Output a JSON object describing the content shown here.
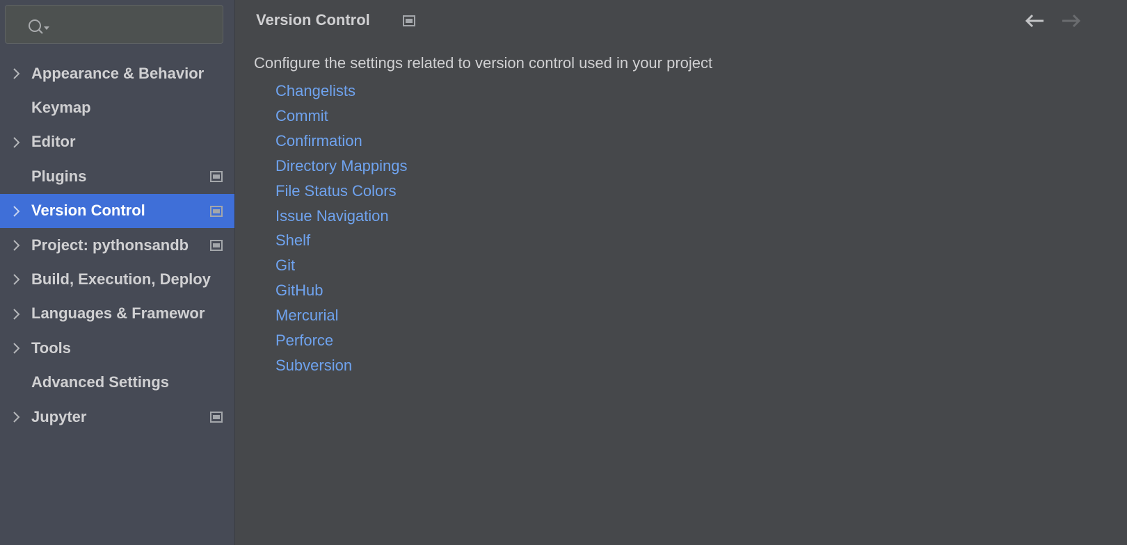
{
  "search": {
    "placeholder": "",
    "icon": "search-icon"
  },
  "sidebar": {
    "items": [
      {
        "label": "Appearance & Behavior",
        "expandable": true,
        "project_icon": false,
        "selected": false
      },
      {
        "label": "Keymap",
        "expandable": false,
        "project_icon": false,
        "selected": false
      },
      {
        "label": "Editor",
        "expandable": true,
        "project_icon": false,
        "selected": false
      },
      {
        "label": "Plugins",
        "expandable": false,
        "project_icon": true,
        "selected": false
      },
      {
        "label": "Version Control",
        "expandable": true,
        "project_icon": true,
        "selected": true
      },
      {
        "label": "Project: pythonsandb",
        "expandable": true,
        "project_icon": true,
        "selected": false
      },
      {
        "label": "Build, Execution, Deploy",
        "expandable": true,
        "project_icon": false,
        "selected": false
      },
      {
        "label": "Languages & Framewor",
        "expandable": true,
        "project_icon": false,
        "selected": false
      },
      {
        "label": "Tools",
        "expandable": true,
        "project_icon": false,
        "selected": false
      },
      {
        "label": "Advanced Settings",
        "expandable": false,
        "project_icon": false,
        "selected": false
      },
      {
        "label": "Jupyter",
        "expandable": true,
        "project_icon": true,
        "selected": false
      }
    ]
  },
  "main": {
    "title": "Version Control",
    "description": "Configure the settings related to version control used in your project",
    "links": [
      "Changelists",
      "Commit",
      "Confirmation",
      "Directory Mappings",
      "File Status Colors",
      "Issue Navigation",
      "Shelf",
      "Git",
      "GitHub",
      "Mercurial",
      "Perforce",
      "Subversion"
    ]
  },
  "colors": {
    "accent": "#3f6fd8",
    "link": "#6fa3ef",
    "sidebar_bg": "#464a55",
    "main_bg": "#46484b"
  }
}
